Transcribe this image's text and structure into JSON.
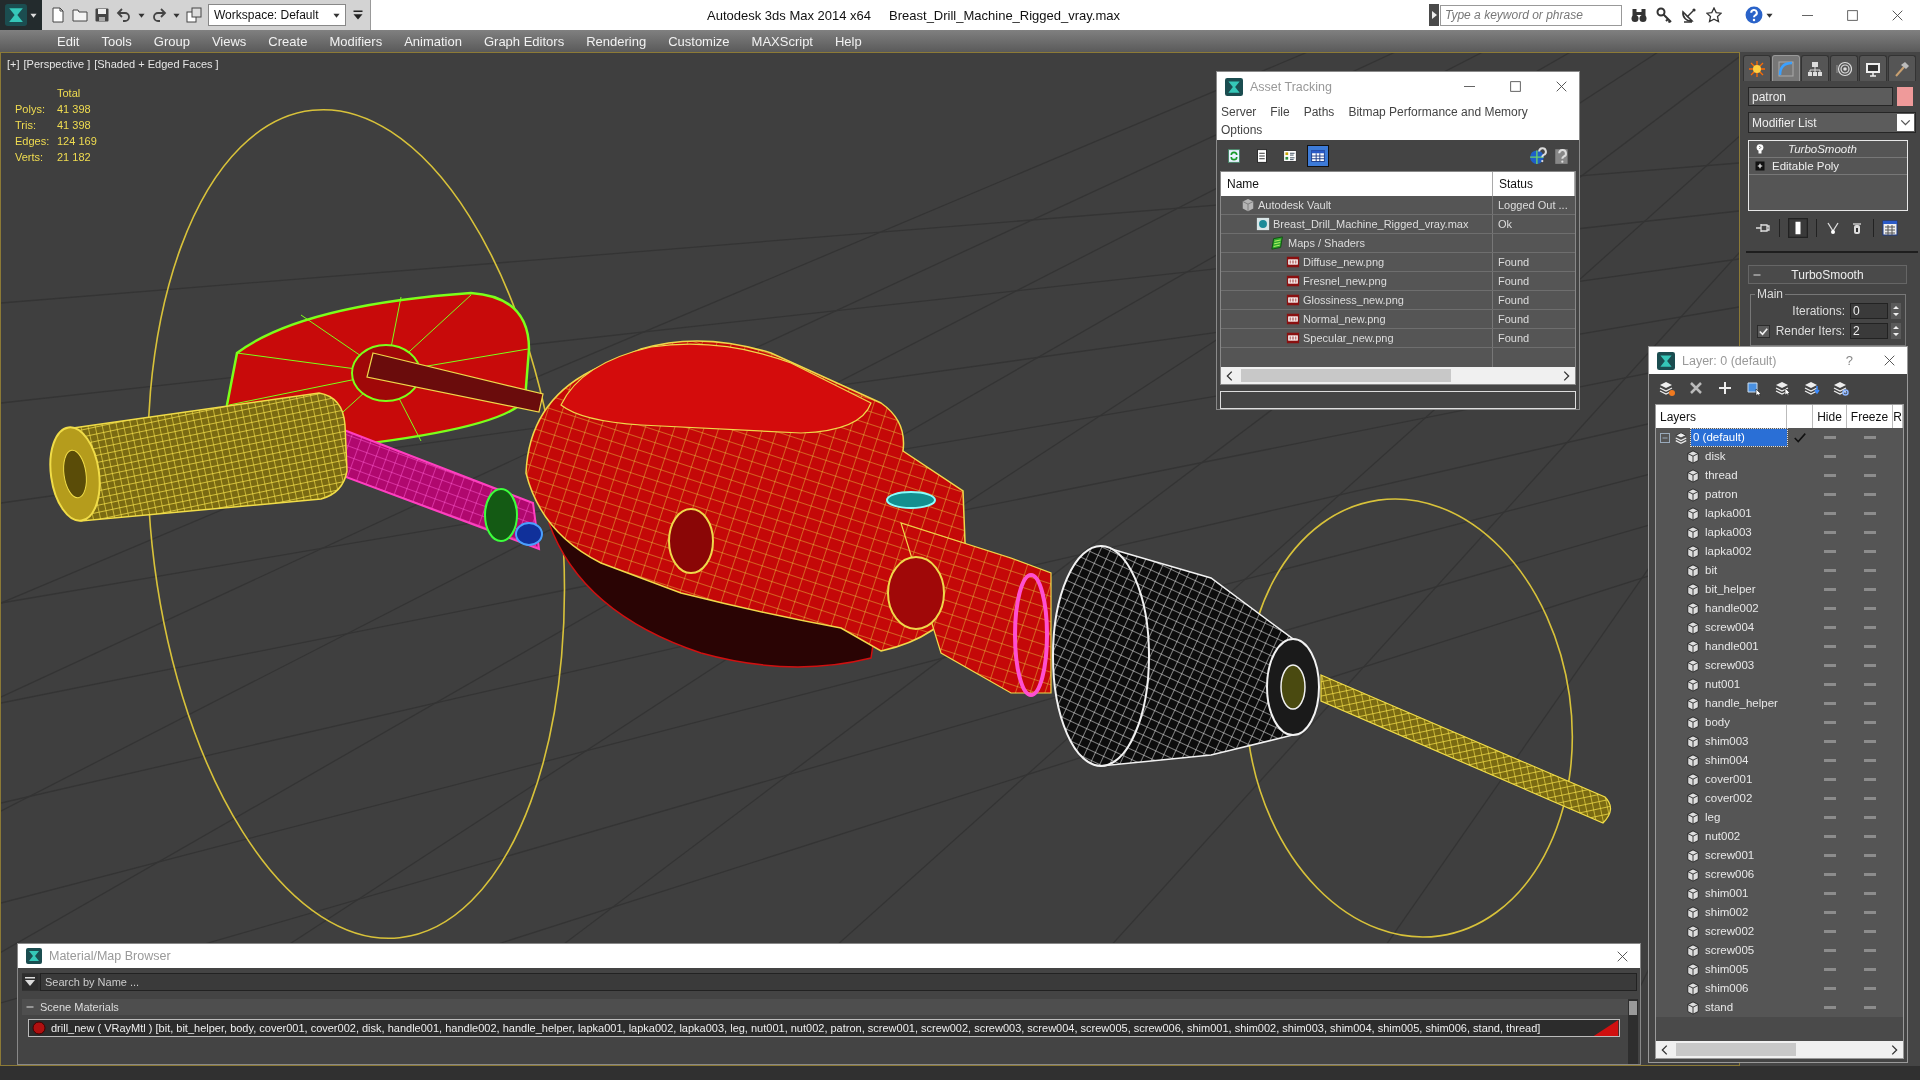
{
  "title_bar": {
    "workspace": "Workspace: Default",
    "app_name": "Autodesk 3ds Max 2014 x64",
    "file_name": "Breast_Drill_Machine_Rigged_vray.max",
    "search": {
      "placeholder": "Type a keyword or phrase"
    }
  },
  "menu_bar": [
    "Edit",
    "Tools",
    "Group",
    "Views",
    "Create",
    "Modifiers",
    "Animation",
    "Graph Editors",
    "Rendering",
    "Customize",
    "MAXScript",
    "Help"
  ],
  "viewport": {
    "labels": [
      "[+]",
      "[Perspective ]",
      "[Shaded + Edged Faces ]"
    ],
    "stats": {
      "heading": "Total",
      "rows": [
        {
          "label": "Polys:",
          "value": "41 398"
        },
        {
          "label": "Tris:",
          "value": "41 398"
        },
        {
          "label": "Edges:",
          "value": "124 169"
        },
        {
          "label": "Verts:",
          "value": "21 182"
        }
      ]
    }
  },
  "asset_tracking": {
    "title": "Asset Tracking",
    "menu": [
      "Server",
      "File",
      "Paths",
      "Bitmap Performance and Memory",
      "Options"
    ],
    "view_buttons": [
      {
        "kind": "refresh",
        "selected": false
      },
      {
        "kind": "list",
        "selected": false
      },
      {
        "kind": "details",
        "selected": false
      },
      {
        "kind": "table",
        "selected": true
      }
    ],
    "columns": [
      "Name",
      "Status"
    ],
    "tree": [
      {
        "kind": "vault",
        "name": "Autodesk Vault",
        "status": "Logged Out ...",
        "children": [
          {
            "kind": "max",
            "name": "Breast_Drill_Machine_Rigged_vray.max",
            "status": "Ok",
            "children": [
              {
                "kind": "maps",
                "name": "Maps / Shaders",
                "children": [
                  {
                    "kind": "png",
                    "name": "Diffuse_new.png",
                    "status": "Found"
                  },
                  {
                    "kind": "png",
                    "name": "Fresnel_new.png",
                    "status": "Found"
                  },
                  {
                    "kind": "png",
                    "name": "Glossiness_new.png",
                    "status": "Found"
                  },
                  {
                    "kind": "png",
                    "name": "Normal_new.png",
                    "status": "Found"
                  },
                  {
                    "kind": "png",
                    "name": "Specular_new.png",
                    "status": "Found"
                  }
                ]
              }
            ]
          }
        ]
      }
    ]
  },
  "command_panel": {
    "tabs": [
      {
        "kind": "create",
        "selected": false
      },
      {
        "kind": "modify",
        "selected": true
      },
      {
        "kind": "hierarchy",
        "selected": false
      },
      {
        "kind": "motion",
        "selected": false
      },
      {
        "kind": "display",
        "selected": false
      },
      {
        "kind": "utilities",
        "selected": false
      }
    ],
    "object_name": "patron",
    "modifier_list": "Modifier List",
    "stack": [
      {
        "kind": "modifier",
        "name": "TurboSmooth"
      },
      {
        "kind": "base",
        "name": "Editable Poly"
      }
    ],
    "rollout": {
      "title": "TurboSmooth",
      "expanded": true,
      "group": "Main",
      "iterations": {
        "label": "Iterations:",
        "value": "0"
      },
      "render_iters": {
        "label": "Render Iters:",
        "value": "2",
        "checked": true
      }
    }
  },
  "layer_manager": {
    "title": "Layer: 0 (default)",
    "help": "?",
    "columns": [
      "Layers",
      "Hide",
      "Freeze",
      "R"
    ],
    "layers": [
      {
        "name": "0 (default)",
        "selected": true,
        "current": true,
        "expanded": true,
        "children": [
          {
            "name": "disk",
            "selected": false,
            "current": false
          },
          {
            "name": "thread",
            "selected": false,
            "current": false
          },
          {
            "name": "patron",
            "selected": false,
            "current": false
          },
          {
            "name": "lapka001",
            "selected": false,
            "current": false
          },
          {
            "name": "lapka003",
            "selected": false,
            "current": false
          },
          {
            "name": "lapka002",
            "selected": false,
            "current": false
          },
          {
            "name": "bit",
            "selected": false,
            "current": false
          },
          {
            "name": "bit_helper",
            "selected": false,
            "current": false
          },
          {
            "name": "handle002",
            "selected": false,
            "current": false
          },
          {
            "name": "screw004",
            "selected": false,
            "current": false
          },
          {
            "name": "handle001",
            "selected": false,
            "current": false
          },
          {
            "name": "screw003",
            "selected": false,
            "current": false
          },
          {
            "name": "nut001",
            "selected": false,
            "current": false
          },
          {
            "name": "handle_helper",
            "selected": false,
            "current": false
          },
          {
            "name": "body",
            "selected": false,
            "current": false
          },
          {
            "name": "shim003",
            "selected": false,
            "current": false
          },
          {
            "name": "shim004",
            "selected": false,
            "current": false
          },
          {
            "name": "cover001",
            "selected": false,
            "current": false
          },
          {
            "name": "cover002",
            "selected": false,
            "current": false
          },
          {
            "name": "leg",
            "selected": false,
            "current": false
          },
          {
            "name": "nut002",
            "selected": false,
            "current": false
          },
          {
            "name": "screw001",
            "selected": false,
            "current": false
          },
          {
            "name": "screw006",
            "selected": false,
            "current": false
          },
          {
            "name": "shim001",
            "selected": false,
            "current": false
          },
          {
            "name": "shim002",
            "selected": false,
            "current": false
          },
          {
            "name": "screw002",
            "selected": false,
            "current": false
          },
          {
            "name": "screw005",
            "selected": false,
            "current": false
          },
          {
            "name": "shim005",
            "selected": false,
            "current": false
          },
          {
            "name": "shim006",
            "selected": false,
            "current": false
          },
          {
            "name": "stand",
            "selected": false,
            "current": false
          }
        ]
      }
    ]
  },
  "material_browser": {
    "title": "Material/Map Browser",
    "search": {
      "placeholder": "Search by Name ..."
    },
    "groups": [
      {
        "title": "Scene Materials",
        "expanded": true,
        "materials": [
          {
            "name": "drill_new ( VRayMtl ) [bit, bit_helper, body, cover001, cover002, disk, handle001, handle002, handle_helper, lapka001, lapka002, lapka003, leg, nut001, nut002, patron, screw001, screw002, screw003, screw004, screw005, screw006, shim001, shim002, shim003, shim004, shim005, shim006, stand, thread]"
          }
        ]
      }
    ]
  }
}
